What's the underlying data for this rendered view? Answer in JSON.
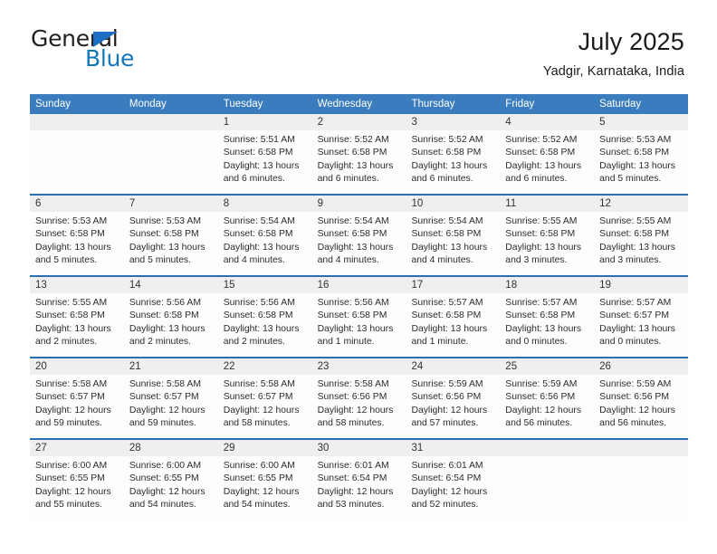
{
  "brand": {
    "word_one": "General",
    "word_two": "Blue",
    "flag_icon": "triangle-flag-icon"
  },
  "header": {
    "title": "July 2025",
    "location": "Yadgir, Karnataka, India"
  },
  "colors": {
    "header_blue": "#3a7cbe",
    "row_rule_blue": "#2c6fb0",
    "date_band_gray": "#efefef",
    "brand_blue": "#1276bd",
    "text_dark": "#222222"
  },
  "calendar": {
    "weekday_headers": [
      "Sunday",
      "Monday",
      "Tuesday",
      "Wednesday",
      "Thursday",
      "Friday",
      "Saturday"
    ],
    "weeks": [
      [
        {
          "date": "",
          "lines": []
        },
        {
          "date": "",
          "lines": []
        },
        {
          "date": "1",
          "lines": [
            "Sunrise: 5:51 AM",
            "Sunset: 6:58 PM",
            "Daylight: 13 hours",
            "and 6 minutes."
          ]
        },
        {
          "date": "2",
          "lines": [
            "Sunrise: 5:52 AM",
            "Sunset: 6:58 PM",
            "Daylight: 13 hours",
            "and 6 minutes."
          ]
        },
        {
          "date": "3",
          "lines": [
            "Sunrise: 5:52 AM",
            "Sunset: 6:58 PM",
            "Daylight: 13 hours",
            "and 6 minutes."
          ]
        },
        {
          "date": "4",
          "lines": [
            "Sunrise: 5:52 AM",
            "Sunset: 6:58 PM",
            "Daylight: 13 hours",
            "and 6 minutes."
          ]
        },
        {
          "date": "5",
          "lines": [
            "Sunrise: 5:53 AM",
            "Sunset: 6:58 PM",
            "Daylight: 13 hours",
            "and 5 minutes."
          ]
        }
      ],
      [
        {
          "date": "6",
          "lines": [
            "Sunrise: 5:53 AM",
            "Sunset: 6:58 PM",
            "Daylight: 13 hours",
            "and 5 minutes."
          ]
        },
        {
          "date": "7",
          "lines": [
            "Sunrise: 5:53 AM",
            "Sunset: 6:58 PM",
            "Daylight: 13 hours",
            "and 5 minutes."
          ]
        },
        {
          "date": "8",
          "lines": [
            "Sunrise: 5:54 AM",
            "Sunset: 6:58 PM",
            "Daylight: 13 hours",
            "and 4 minutes."
          ]
        },
        {
          "date": "9",
          "lines": [
            "Sunrise: 5:54 AM",
            "Sunset: 6:58 PM",
            "Daylight: 13 hours",
            "and 4 minutes."
          ]
        },
        {
          "date": "10",
          "lines": [
            "Sunrise: 5:54 AM",
            "Sunset: 6:58 PM",
            "Daylight: 13 hours",
            "and 4 minutes."
          ]
        },
        {
          "date": "11",
          "lines": [
            "Sunrise: 5:55 AM",
            "Sunset: 6:58 PM",
            "Daylight: 13 hours",
            "and 3 minutes."
          ]
        },
        {
          "date": "12",
          "lines": [
            "Sunrise: 5:55 AM",
            "Sunset: 6:58 PM",
            "Daylight: 13 hours",
            "and 3 minutes."
          ]
        }
      ],
      [
        {
          "date": "13",
          "lines": [
            "Sunrise: 5:55 AM",
            "Sunset: 6:58 PM",
            "Daylight: 13 hours",
            "and 2 minutes."
          ]
        },
        {
          "date": "14",
          "lines": [
            "Sunrise: 5:56 AM",
            "Sunset: 6:58 PM",
            "Daylight: 13 hours",
            "and 2 minutes."
          ]
        },
        {
          "date": "15",
          "lines": [
            "Sunrise: 5:56 AM",
            "Sunset: 6:58 PM",
            "Daylight: 13 hours",
            "and 2 minutes."
          ]
        },
        {
          "date": "16",
          "lines": [
            "Sunrise: 5:56 AM",
            "Sunset: 6:58 PM",
            "Daylight: 13 hours",
            "and 1 minute."
          ]
        },
        {
          "date": "17",
          "lines": [
            "Sunrise: 5:57 AM",
            "Sunset: 6:58 PM",
            "Daylight: 13 hours",
            "and 1 minute."
          ]
        },
        {
          "date": "18",
          "lines": [
            "Sunrise: 5:57 AM",
            "Sunset: 6:58 PM",
            "Daylight: 13 hours",
            "and 0 minutes."
          ]
        },
        {
          "date": "19",
          "lines": [
            "Sunrise: 5:57 AM",
            "Sunset: 6:57 PM",
            "Daylight: 13 hours",
            "and 0 minutes."
          ]
        }
      ],
      [
        {
          "date": "20",
          "lines": [
            "Sunrise: 5:58 AM",
            "Sunset: 6:57 PM",
            "Daylight: 12 hours",
            "and 59 minutes."
          ]
        },
        {
          "date": "21",
          "lines": [
            "Sunrise: 5:58 AM",
            "Sunset: 6:57 PM",
            "Daylight: 12 hours",
            "and 59 minutes."
          ]
        },
        {
          "date": "22",
          "lines": [
            "Sunrise: 5:58 AM",
            "Sunset: 6:57 PM",
            "Daylight: 12 hours",
            "and 58 minutes."
          ]
        },
        {
          "date": "23",
          "lines": [
            "Sunrise: 5:58 AM",
            "Sunset: 6:56 PM",
            "Daylight: 12 hours",
            "and 58 minutes."
          ]
        },
        {
          "date": "24",
          "lines": [
            "Sunrise: 5:59 AM",
            "Sunset: 6:56 PM",
            "Daylight: 12 hours",
            "and 57 minutes."
          ]
        },
        {
          "date": "25",
          "lines": [
            "Sunrise: 5:59 AM",
            "Sunset: 6:56 PM",
            "Daylight: 12 hours",
            "and 56 minutes."
          ]
        },
        {
          "date": "26",
          "lines": [
            "Sunrise: 5:59 AM",
            "Sunset: 6:56 PM",
            "Daylight: 12 hours",
            "and 56 minutes."
          ]
        }
      ],
      [
        {
          "date": "27",
          "lines": [
            "Sunrise: 6:00 AM",
            "Sunset: 6:55 PM",
            "Daylight: 12 hours",
            "and 55 minutes."
          ]
        },
        {
          "date": "28",
          "lines": [
            "Sunrise: 6:00 AM",
            "Sunset: 6:55 PM",
            "Daylight: 12 hours",
            "and 54 minutes."
          ]
        },
        {
          "date": "29",
          "lines": [
            "Sunrise: 6:00 AM",
            "Sunset: 6:55 PM",
            "Daylight: 12 hours",
            "and 54 minutes."
          ]
        },
        {
          "date": "30",
          "lines": [
            "Sunrise: 6:01 AM",
            "Sunset: 6:54 PM",
            "Daylight: 12 hours",
            "and 53 minutes."
          ]
        },
        {
          "date": "31",
          "lines": [
            "Sunrise: 6:01 AM",
            "Sunset: 6:54 PM",
            "Daylight: 12 hours",
            "and 52 minutes."
          ]
        },
        {
          "date": "",
          "lines": []
        },
        {
          "date": "",
          "lines": []
        }
      ]
    ]
  }
}
